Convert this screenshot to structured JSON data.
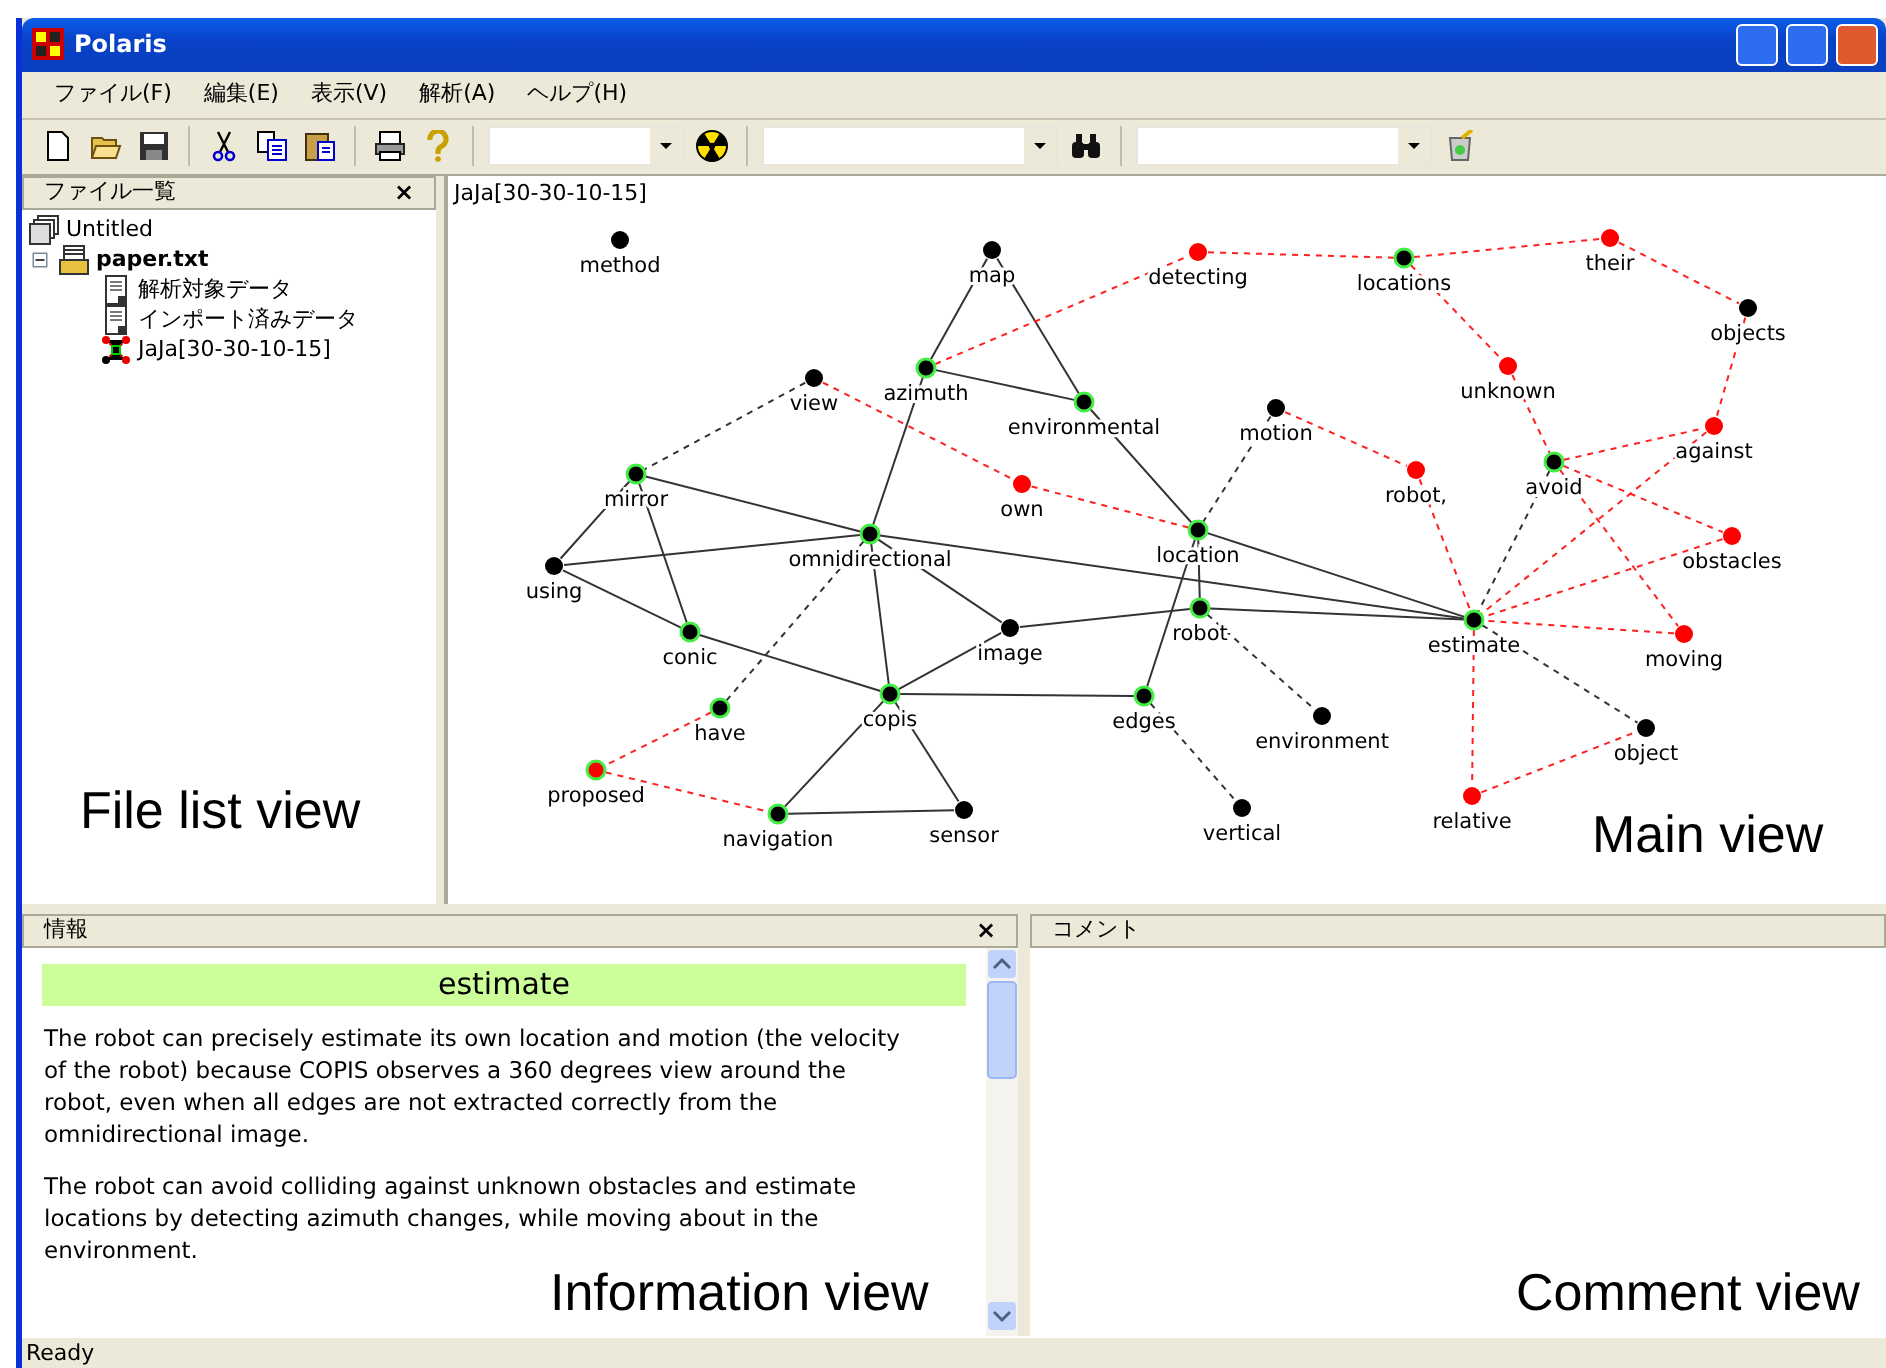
{
  "window": {
    "title": "Polaris"
  },
  "menu": [
    "ファイル(F)",
    "編集(E)",
    "表示(V)",
    "解析(A)",
    "ヘルプ(H)"
  ],
  "file_list": {
    "title": "ファイル一覧",
    "close": "×",
    "tree": [
      {
        "label": "Untitled",
        "kind": "workspace"
      },
      {
        "label": "paper.txt",
        "kind": "file",
        "expanded": true,
        "children": [
          {
            "label": "解析対象データ",
            "kind": "data"
          },
          {
            "label": "インポート済みデータ",
            "kind": "data"
          },
          {
            "label": "JaJa[30-30-10-15]",
            "kind": "graph"
          }
        ]
      }
    ]
  },
  "main_view": {
    "title": "JaJa[30-30-10-15]",
    "nodes": [
      {
        "label": "method",
        "color": "#000000",
        "highlighted": false
      },
      {
        "label": "map",
        "color": "#000000",
        "highlighted": false
      },
      {
        "label": "detecting",
        "color": "#ff0000",
        "highlighted": false
      },
      {
        "label": "locations",
        "color": "#000000",
        "highlighted": true
      },
      {
        "label": "their",
        "color": "#ff0000",
        "highlighted": false
      },
      {
        "label": "objects",
        "color": "#000000",
        "highlighted": false
      },
      {
        "label": "view",
        "color": "#000000",
        "highlighted": false
      },
      {
        "label": "azimuth",
        "color": "#000000",
        "highlighted": true
      },
      {
        "label": "unknown",
        "color": "#ff0000",
        "highlighted": false
      },
      {
        "label": "environmental",
        "color": "#000000",
        "highlighted": true
      },
      {
        "label": "motion",
        "color": "#000000",
        "highlighted": false
      },
      {
        "label": "against",
        "color": "#ff0000",
        "highlighted": false
      },
      {
        "label": "mirror",
        "color": "#000000",
        "highlighted": true
      },
      {
        "label": "own",
        "color": "#ff0000",
        "highlighted": false
      },
      {
        "label": "robot,",
        "color": "#ff0000",
        "highlighted": false
      },
      {
        "label": "avoid",
        "color": "#000000",
        "highlighted": true
      },
      {
        "label": "omnidirectional",
        "color": "#000000",
        "highlighted": true
      },
      {
        "label": "location",
        "color": "#000000",
        "highlighted": true
      },
      {
        "label": "obstacles",
        "color": "#ff0000",
        "highlighted": false
      },
      {
        "label": "using",
        "color": "#000000",
        "highlighted": false
      },
      {
        "label": "conic",
        "color": "#000000",
        "highlighted": true
      },
      {
        "label": "image",
        "color": "#000000",
        "highlighted": false
      },
      {
        "label": "robot",
        "color": "#000000",
        "highlighted": true
      },
      {
        "label": "estimate",
        "color": "#000000",
        "highlighted": true
      },
      {
        "label": "moving",
        "color": "#ff0000",
        "highlighted": false
      },
      {
        "label": "have",
        "color": "#000000",
        "highlighted": true
      },
      {
        "label": "copis",
        "color": "#000000",
        "highlighted": true
      },
      {
        "label": "edges",
        "color": "#000000",
        "highlighted": true
      },
      {
        "label": "environment",
        "color": "#000000",
        "highlighted": false
      },
      {
        "label": "object",
        "color": "#000000",
        "highlighted": false
      },
      {
        "label": "proposed",
        "color": "#ff0000",
        "highlighted": true
      },
      {
        "label": "navigation",
        "color": "#000000",
        "highlighted": true
      },
      {
        "label": "sensor",
        "color": "#000000",
        "highlighted": false
      },
      {
        "label": "vertical",
        "color": "#000000",
        "highlighted": false
      },
      {
        "label": "relative",
        "color": "#ff0000",
        "highlighted": false
      }
    ],
    "edges": [
      {
        "kind": "solid"
      },
      {
        "kind": "solid"
      },
      {
        "kind": "solid"
      },
      {
        "kind": "solid"
      },
      {
        "kind": "solid"
      },
      {
        "kind": "solid"
      },
      {
        "kind": "solid"
      },
      {
        "kind": "solid"
      },
      {
        "kind": "solid"
      },
      {
        "kind": "solid"
      },
      {
        "kind": "solid"
      },
      {
        "kind": "solid"
      },
      {
        "kind": "solid"
      },
      {
        "kind": "solid"
      },
      {
        "kind": "solid"
      },
      {
        "kind": "solid"
      },
      {
        "kind": "solid"
      },
      {
        "kind": "solid"
      },
      {
        "kind": "solid"
      },
      {
        "kind": "solid"
      },
      {
        "kind": "solid"
      },
      {
        "kind": "solid"
      },
      {
        "kind": "solid"
      },
      {
        "kind": "solid"
      },
      {
        "kind": "dashed"
      },
      {
        "kind": "dashed"
      },
      {
        "kind": "dashed"
      },
      {
        "kind": "dashed"
      },
      {
        "kind": "dashed"
      },
      {
        "kind": "dashed"
      },
      {
        "kind": "dashed"
      },
      {
        "kind": "dashed-red"
      },
      {
        "kind": "dashed-red"
      },
      {
        "kind": "dashed-red"
      },
      {
        "kind": "dashed-red"
      },
      {
        "kind": "dashed-red"
      },
      {
        "kind": "dashed-red"
      },
      {
        "kind": "dashed-red"
      },
      {
        "kind": "dashed-red"
      },
      {
        "kind": "dashed-red"
      },
      {
        "kind": "dashed-red"
      },
      {
        "kind": "dashed-red"
      },
      {
        "kind": "dashed-red"
      },
      {
        "kind": "dashed-red"
      },
      {
        "kind": "dashed-red"
      },
      {
        "kind": "dashed-red"
      },
      {
        "kind": "dashed-red"
      },
      {
        "kind": "dashed-red"
      },
      {
        "kind": "dashed-red"
      },
      {
        "kind": "dashed-red"
      },
      {
        "kind": "dashed-red"
      },
      {
        "kind": "dashed-red"
      }
    ]
  },
  "information": {
    "title": "情報",
    "close": "×",
    "heading": "estimate",
    "paragraphs": [
      "The robot can precisely estimate its own location and motion (the velocity of the robot) because COPIS observes a 360 degrees view around the robot, even when all edges are not extracted correctly from the omnidirectional image.",
      "The robot can avoid colliding against unknown obstacles and estimate locations by detecting azimuth changes, while moving about in the environment."
    ]
  },
  "comment": {
    "title": "コメント"
  },
  "status_bar": "Ready",
  "annotations": [
    {
      "text": "File list view"
    },
    {
      "text": "Main view"
    },
    {
      "text": "Information view"
    },
    {
      "text": "Comment view"
    }
  ]
}
